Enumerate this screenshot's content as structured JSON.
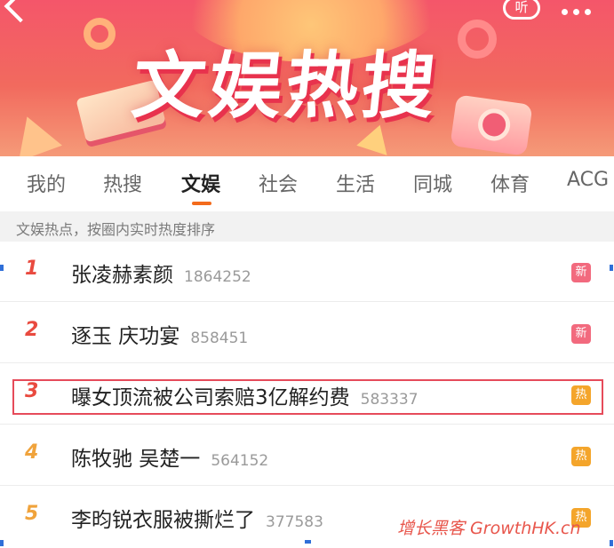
{
  "banner": {
    "title": "文娱热搜",
    "listen_label": "听"
  },
  "tabs": [
    {
      "label": "我的"
    },
    {
      "label": "热搜"
    },
    {
      "label": "文娱",
      "active": true
    },
    {
      "label": "社会"
    },
    {
      "label": "生活"
    },
    {
      "label": "同城"
    },
    {
      "label": "体育"
    },
    {
      "label": "ACG"
    }
  ],
  "hint": "文娱热点，按圈内实时热度排序",
  "items": [
    {
      "rank": "1",
      "title": "张凌赫素颜",
      "count": "1864252",
      "badge": "新"
    },
    {
      "rank": "2",
      "title": "逐玉 庆功宴",
      "count": "858451",
      "badge": "新"
    },
    {
      "rank": "3",
      "title": "曝女顶流被公司索赔3亿解约费",
      "count": "583337",
      "badge": "热"
    },
    {
      "rank": "4",
      "title": "陈牧驰 吴楚一",
      "count": "564152",
      "badge": "热"
    },
    {
      "rank": "5",
      "title": "李昀锐衣服被撕烂了",
      "count": "377583",
      "badge": "热"
    }
  ],
  "watermark": "增长黑客 GrowthHK.cn",
  "colors": {
    "accent": "#f36b1c",
    "rank_top": "#e94a3f",
    "rank_other": "#f0a33c",
    "badge_new": "#f26a7e",
    "badge_hot": "#f4a52b",
    "highlight_box": "#e64b5a"
  }
}
